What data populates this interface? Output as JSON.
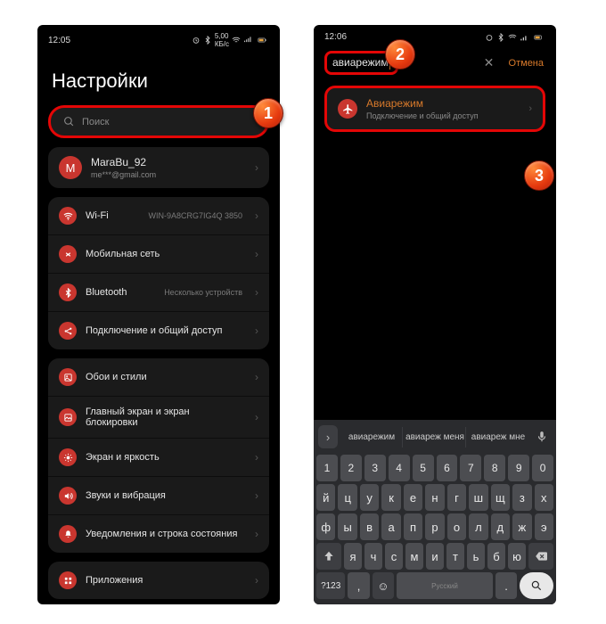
{
  "badges": [
    "1",
    "2",
    "3"
  ],
  "left": {
    "time": "12:05",
    "title": "Настройки",
    "search_placeholder": "Поиск",
    "account": {
      "initial": "M",
      "name": "MaraBu_92",
      "email": "me***@gmail.com"
    },
    "group1": [
      {
        "icon": "wifi",
        "label": "Wi-Fi",
        "value": "WIN-9A8CRG7IG4Q 3850"
      },
      {
        "icon": "sim",
        "label": "Мобильная сеть",
        "value": ""
      },
      {
        "icon": "bt",
        "label": "Bluetooth",
        "value": "Несколько устройств"
      },
      {
        "icon": "share",
        "label": "Подключение и общий доступ",
        "value": ""
      }
    ],
    "group2": [
      {
        "icon": "wall",
        "label": "Обои и стили",
        "value": ""
      },
      {
        "icon": "home",
        "label": "Главный экран и экран блокировки",
        "value": ""
      },
      {
        "icon": "sun",
        "label": "Экран и яркость",
        "value": ""
      },
      {
        "icon": "sound",
        "label": "Звуки и вибрация",
        "value": ""
      },
      {
        "icon": "bell",
        "label": "Уведомления и строка состояния",
        "value": ""
      }
    ],
    "group3": [
      {
        "icon": "apps",
        "label": "Приложения",
        "value": ""
      }
    ]
  },
  "right": {
    "time": "12:06",
    "search_value": "авиарежим",
    "cancel": "Отмена",
    "result": {
      "title": "Авиарежим",
      "sub": "Подключение и общий доступ"
    },
    "suggestions": [
      "авиарежим",
      "авиареж меня",
      "авиареж мне"
    ],
    "kb": {
      "r1": [
        "1",
        "2",
        "3",
        "4",
        "5",
        "6",
        "7",
        "8",
        "9",
        "0"
      ],
      "r2": [
        "й",
        "ц",
        "у",
        "к",
        "е",
        "н",
        "г",
        "ш",
        "щ",
        "з",
        "х"
      ],
      "r3": [
        "ф",
        "ы",
        "в",
        "а",
        "п",
        "р",
        "о",
        "л",
        "д",
        "ж",
        "э"
      ],
      "r4": [
        "я",
        "ч",
        "с",
        "м",
        "и",
        "т",
        "ь",
        "б",
        "ю"
      ],
      "mode": "?123",
      "lang": "Русский",
      "comma": ",",
      "dot": "."
    }
  }
}
